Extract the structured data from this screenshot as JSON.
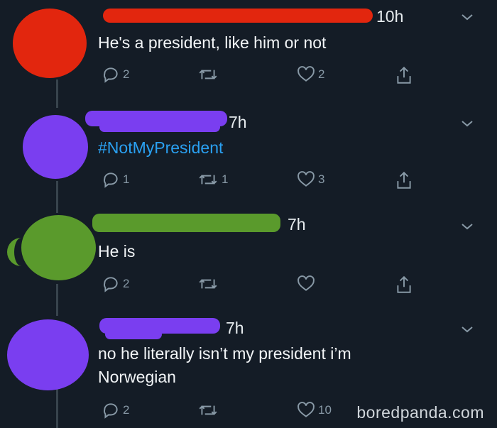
{
  "colors": {
    "background": "#141c26",
    "icon_gray": "#8899a6",
    "hashtag_blue": "#2aa1f2",
    "redaction_red": "#e2260e",
    "redaction_purple": "#7a3ef0",
    "redaction_green": "#5a9a2c"
  },
  "tweets": [
    {
      "time": "10h",
      "text": "He's a president, like him or not",
      "reply_count": "2",
      "retweet_count": "",
      "like_count": "2"
    },
    {
      "time": "7h",
      "text": "#NotMyPresident",
      "reply_count": "1",
      "retweet_count": "1",
      "like_count": "3"
    },
    {
      "time": "7h",
      "text": "He is",
      "reply_count": "2",
      "retweet_count": "",
      "like_count": ""
    },
    {
      "time": "7h",
      "text_line1": "no he literally isn’t my president i’m",
      "text_line2": "Norwegian",
      "reply_count": "2",
      "retweet_count": "",
      "like_count": "10"
    }
  ],
  "watermark": "boredpanda.com",
  "icons": [
    "reply-icon",
    "retweet-icon",
    "like-icon",
    "share-icon",
    "chevron-down-icon"
  ]
}
